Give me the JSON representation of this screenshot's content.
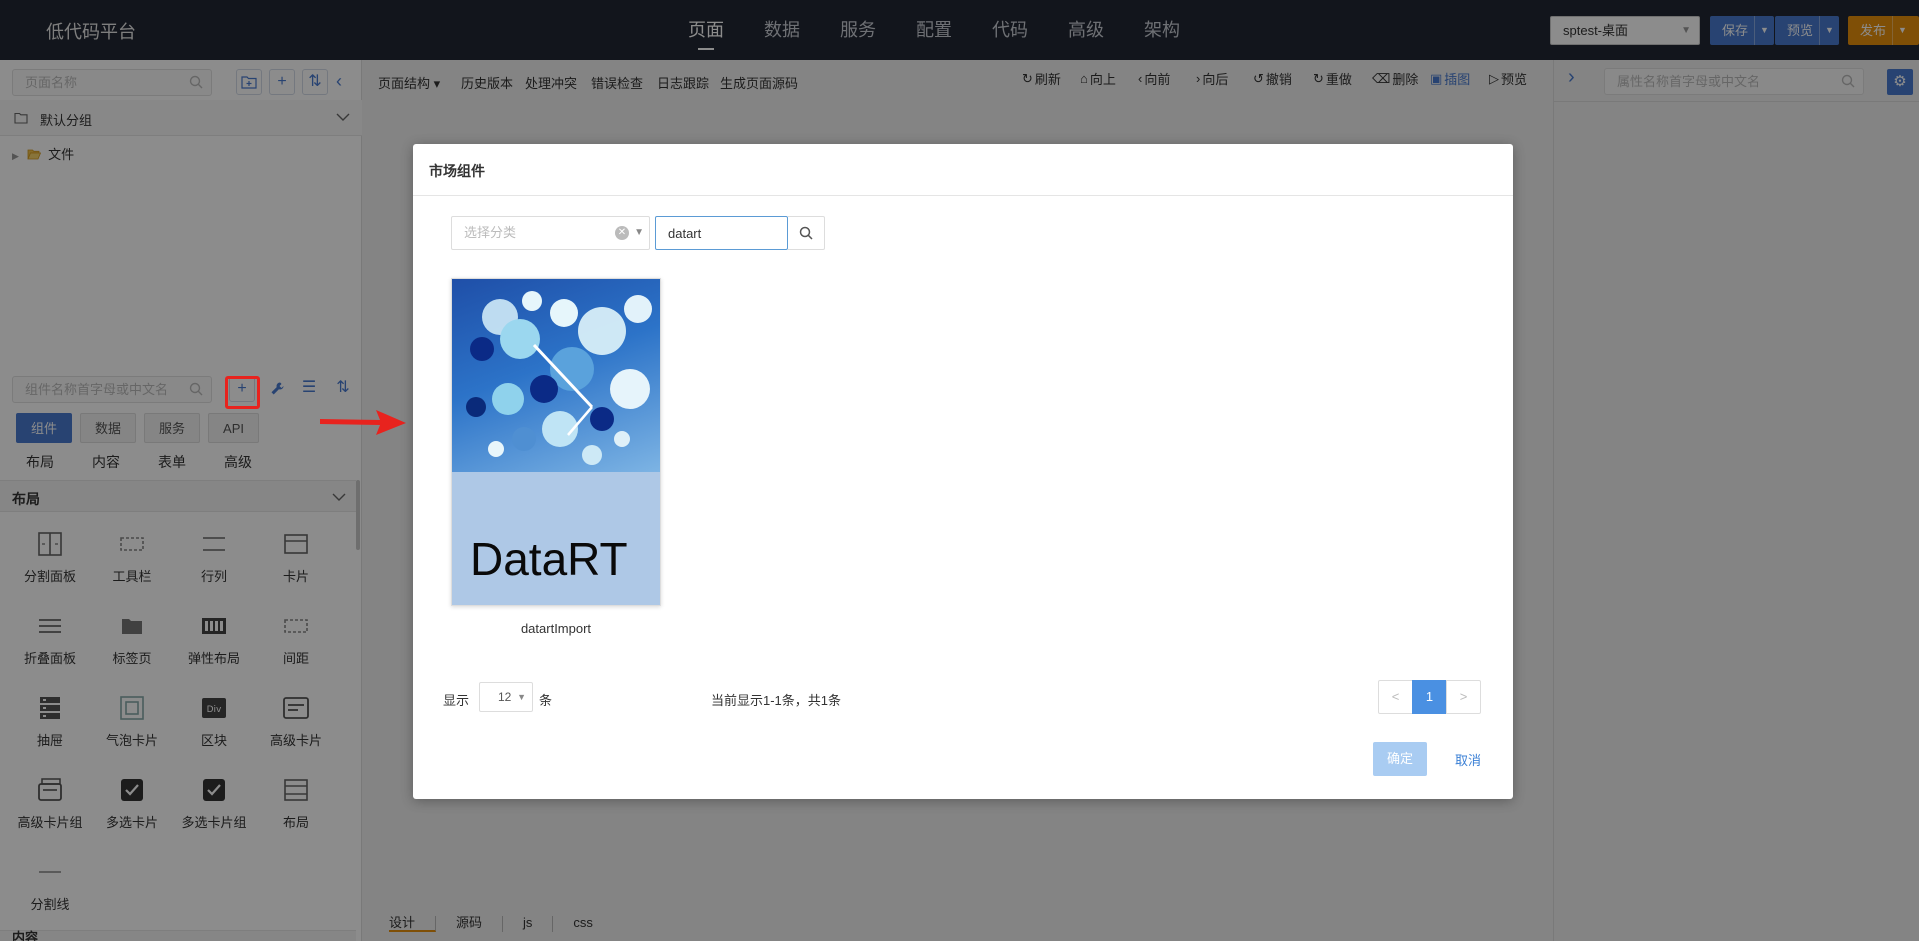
{
  "header": {
    "app_title": "低代码平台",
    "nav": [
      "页面",
      "数据",
      "服务",
      "配置",
      "代码",
      "高级",
      "架构"
    ],
    "active_nav": "页面",
    "app_selector": "sptest-桌面",
    "save_label": "保存",
    "preview_label": "预览",
    "publish_label": "发布"
  },
  "left_panel": {
    "page_search_placeholder": "页面名称",
    "group_label": "默认分组",
    "tree_item": "文件",
    "component_search_placeholder": "组件名称首字母或中文名",
    "tabs": [
      "组件",
      "数据",
      "服务",
      "API"
    ],
    "active_tab": "组件",
    "subtabs": [
      "布局",
      "内容",
      "表单",
      "高级"
    ],
    "section_title": "布局",
    "components": [
      "分割面板",
      "工具栏",
      "行列",
      "卡片",
      "折叠面板",
      "标签页",
      "弹性布局",
      "间距",
      "抽屉",
      "气泡卡片",
      "区块",
      "高级卡片",
      "高级卡片组",
      "多选卡片",
      "多选卡片组",
      "布局",
      "分割线"
    ],
    "next_section_title": "内容"
  },
  "center_toolbar": {
    "left_items": [
      "页面结构 ▾",
      "历史版本",
      "处理冲突",
      "错误检查",
      "日志跟踪",
      "生成页面源码"
    ],
    "right_items": [
      "刷新",
      "向上",
      "向前",
      "向后",
      "撤销",
      "重做",
      "删除",
      "插图",
      "预览"
    ],
    "active_right": "插图"
  },
  "bottom_tabs": [
    "设计",
    "源码",
    "js",
    "css"
  ],
  "right_panel": {
    "property_search_placeholder": "属性名称首字母或中文名"
  },
  "modal": {
    "title": "市场组件",
    "category_placeholder": "选择分类",
    "keyword_value": "datart",
    "card": {
      "logo_text": "DataRT",
      "name": "datartImport"
    },
    "show_label": "显示",
    "page_size": "12",
    "unit_label": "条",
    "info": "当前显示1-1条，共1条",
    "prev": "<",
    "current_page": "1",
    "next": ">",
    "ok_label": "确定",
    "cancel_label": "取消"
  },
  "colors": {
    "topbar": "#222733",
    "primary": "#4a7bd0",
    "publish": "#e8900c",
    "highlight": "#e8231e"
  }
}
